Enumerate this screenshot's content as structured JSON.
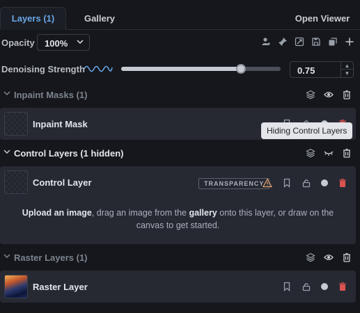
{
  "tabs": {
    "layers": "Layers (1)",
    "gallery": "Gallery",
    "open_viewer": "Open Viewer"
  },
  "opacity": {
    "label": "Opacity",
    "value": "100%"
  },
  "denoise": {
    "label": "Denoising Strength",
    "value": "0.75",
    "level": 0.75
  },
  "groups": {
    "inpaint": {
      "title": "Inpaint Masks (1)",
      "layer_name": "Inpaint Mask"
    },
    "control": {
      "title": "Control Layers (1 hidden)",
      "layer_name": "Control Layer",
      "badge": "TRANSPARENCY"
    },
    "raster": {
      "title": "Raster Layers (1)",
      "layer_name": "Raster Layer"
    }
  },
  "hint": {
    "upload": "Upload an image",
    "mid": ", drag an image from the ",
    "gallery": "gallery",
    "end1": " onto this layer, or draw on the",
    "end2": "canvas to get started."
  },
  "tooltip": "Hiding Control Layers",
  "colors": {
    "accent": "#6aa8e8",
    "background": "#15171c",
    "card": "#262932",
    "delete": "#d9534f",
    "warning": "#e0a070"
  }
}
